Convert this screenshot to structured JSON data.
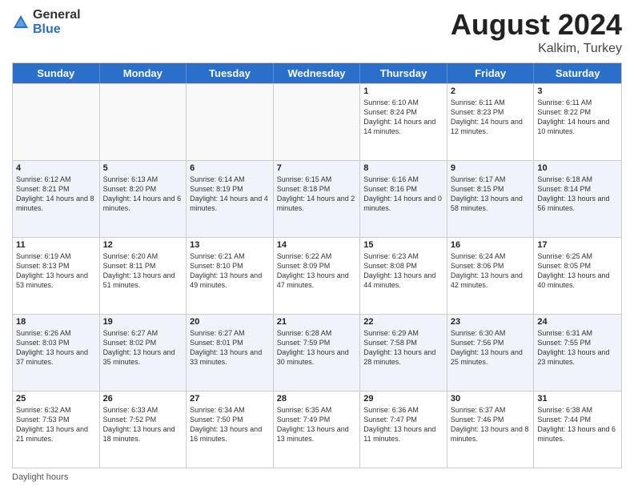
{
  "header": {
    "logo_general": "General",
    "logo_blue": "Blue",
    "title": "August 2024",
    "location": "Kalkim, Turkey"
  },
  "days_of_week": [
    "Sunday",
    "Monday",
    "Tuesday",
    "Wednesday",
    "Thursday",
    "Friday",
    "Saturday"
  ],
  "footer": {
    "daylight_label": "Daylight hours"
  },
  "weeks": [
    [
      {
        "day": "",
        "sunrise": "",
        "sunset": "",
        "daylight": ""
      },
      {
        "day": "",
        "sunrise": "",
        "sunset": "",
        "daylight": ""
      },
      {
        "day": "",
        "sunrise": "",
        "sunset": "",
        "daylight": ""
      },
      {
        "day": "",
        "sunrise": "",
        "sunset": "",
        "daylight": ""
      },
      {
        "day": "1",
        "sunrise": "Sunrise: 6:10 AM",
        "sunset": "Sunset: 8:24 PM",
        "daylight": "Daylight: 14 hours and 14 minutes."
      },
      {
        "day": "2",
        "sunrise": "Sunrise: 6:11 AM",
        "sunset": "Sunset: 8:23 PM",
        "daylight": "Daylight: 14 hours and 12 minutes."
      },
      {
        "day": "3",
        "sunrise": "Sunrise: 6:11 AM",
        "sunset": "Sunset: 8:22 PM",
        "daylight": "Daylight: 14 hours and 10 minutes."
      }
    ],
    [
      {
        "day": "4",
        "sunrise": "Sunrise: 6:12 AM",
        "sunset": "Sunset: 8:21 PM",
        "daylight": "Daylight: 14 hours and 8 minutes."
      },
      {
        "day": "5",
        "sunrise": "Sunrise: 6:13 AM",
        "sunset": "Sunset: 8:20 PM",
        "daylight": "Daylight: 14 hours and 6 minutes."
      },
      {
        "day": "6",
        "sunrise": "Sunrise: 6:14 AM",
        "sunset": "Sunset: 8:19 PM",
        "daylight": "Daylight: 14 hours and 4 minutes."
      },
      {
        "day": "7",
        "sunrise": "Sunrise: 6:15 AM",
        "sunset": "Sunset: 8:18 PM",
        "daylight": "Daylight: 14 hours and 2 minutes."
      },
      {
        "day": "8",
        "sunrise": "Sunrise: 6:16 AM",
        "sunset": "Sunset: 8:16 PM",
        "daylight": "Daylight: 14 hours and 0 minutes."
      },
      {
        "day": "9",
        "sunrise": "Sunrise: 6:17 AM",
        "sunset": "Sunset: 8:15 PM",
        "daylight": "Daylight: 13 hours and 58 minutes."
      },
      {
        "day": "10",
        "sunrise": "Sunrise: 6:18 AM",
        "sunset": "Sunset: 8:14 PM",
        "daylight": "Daylight: 13 hours and 56 minutes."
      }
    ],
    [
      {
        "day": "11",
        "sunrise": "Sunrise: 6:19 AM",
        "sunset": "Sunset: 8:13 PM",
        "daylight": "Daylight: 13 hours and 53 minutes."
      },
      {
        "day": "12",
        "sunrise": "Sunrise: 6:20 AM",
        "sunset": "Sunset: 8:11 PM",
        "daylight": "Daylight: 13 hours and 51 minutes."
      },
      {
        "day": "13",
        "sunrise": "Sunrise: 6:21 AM",
        "sunset": "Sunset: 8:10 PM",
        "daylight": "Daylight: 13 hours and 49 minutes."
      },
      {
        "day": "14",
        "sunrise": "Sunrise: 6:22 AM",
        "sunset": "Sunset: 8:09 PM",
        "daylight": "Daylight: 13 hours and 47 minutes."
      },
      {
        "day": "15",
        "sunrise": "Sunrise: 6:23 AM",
        "sunset": "Sunset: 8:08 PM",
        "daylight": "Daylight: 13 hours and 44 minutes."
      },
      {
        "day": "16",
        "sunrise": "Sunrise: 6:24 AM",
        "sunset": "Sunset: 8:06 PM",
        "daylight": "Daylight: 13 hours and 42 minutes."
      },
      {
        "day": "17",
        "sunrise": "Sunrise: 6:25 AM",
        "sunset": "Sunset: 8:05 PM",
        "daylight": "Daylight: 13 hours and 40 minutes."
      }
    ],
    [
      {
        "day": "18",
        "sunrise": "Sunrise: 6:26 AM",
        "sunset": "Sunset: 8:03 PM",
        "daylight": "Daylight: 13 hours and 37 minutes."
      },
      {
        "day": "19",
        "sunrise": "Sunrise: 6:27 AM",
        "sunset": "Sunset: 8:02 PM",
        "daylight": "Daylight: 13 hours and 35 minutes."
      },
      {
        "day": "20",
        "sunrise": "Sunrise: 6:27 AM",
        "sunset": "Sunset: 8:01 PM",
        "daylight": "Daylight: 13 hours and 33 minutes."
      },
      {
        "day": "21",
        "sunrise": "Sunrise: 6:28 AM",
        "sunset": "Sunset: 7:59 PM",
        "daylight": "Daylight: 13 hours and 30 minutes."
      },
      {
        "day": "22",
        "sunrise": "Sunrise: 6:29 AM",
        "sunset": "Sunset: 7:58 PM",
        "daylight": "Daylight: 13 hours and 28 minutes."
      },
      {
        "day": "23",
        "sunrise": "Sunrise: 6:30 AM",
        "sunset": "Sunset: 7:56 PM",
        "daylight": "Daylight: 13 hours and 25 minutes."
      },
      {
        "day": "24",
        "sunrise": "Sunrise: 6:31 AM",
        "sunset": "Sunset: 7:55 PM",
        "daylight": "Daylight: 13 hours and 23 minutes."
      }
    ],
    [
      {
        "day": "25",
        "sunrise": "Sunrise: 6:32 AM",
        "sunset": "Sunset: 7:53 PM",
        "daylight": "Daylight: 13 hours and 21 minutes."
      },
      {
        "day": "26",
        "sunrise": "Sunrise: 6:33 AM",
        "sunset": "Sunset: 7:52 PM",
        "daylight": "Daylight: 13 hours and 18 minutes."
      },
      {
        "day": "27",
        "sunrise": "Sunrise: 6:34 AM",
        "sunset": "Sunset: 7:50 PM",
        "daylight": "Daylight: 13 hours and 16 minutes."
      },
      {
        "day": "28",
        "sunrise": "Sunrise: 6:35 AM",
        "sunset": "Sunset: 7:49 PM",
        "daylight": "Daylight: 13 hours and 13 minutes."
      },
      {
        "day": "29",
        "sunrise": "Sunrise: 6:36 AM",
        "sunset": "Sunset: 7:47 PM",
        "daylight": "Daylight: 13 hours and 11 minutes."
      },
      {
        "day": "30",
        "sunrise": "Sunrise: 6:37 AM",
        "sunset": "Sunset: 7:46 PM",
        "daylight": "Daylight: 13 hours and 8 minutes."
      },
      {
        "day": "31",
        "sunrise": "Sunrise: 6:38 AM",
        "sunset": "Sunset: 7:44 PM",
        "daylight": "Daylight: 13 hours and 6 minutes."
      }
    ]
  ]
}
